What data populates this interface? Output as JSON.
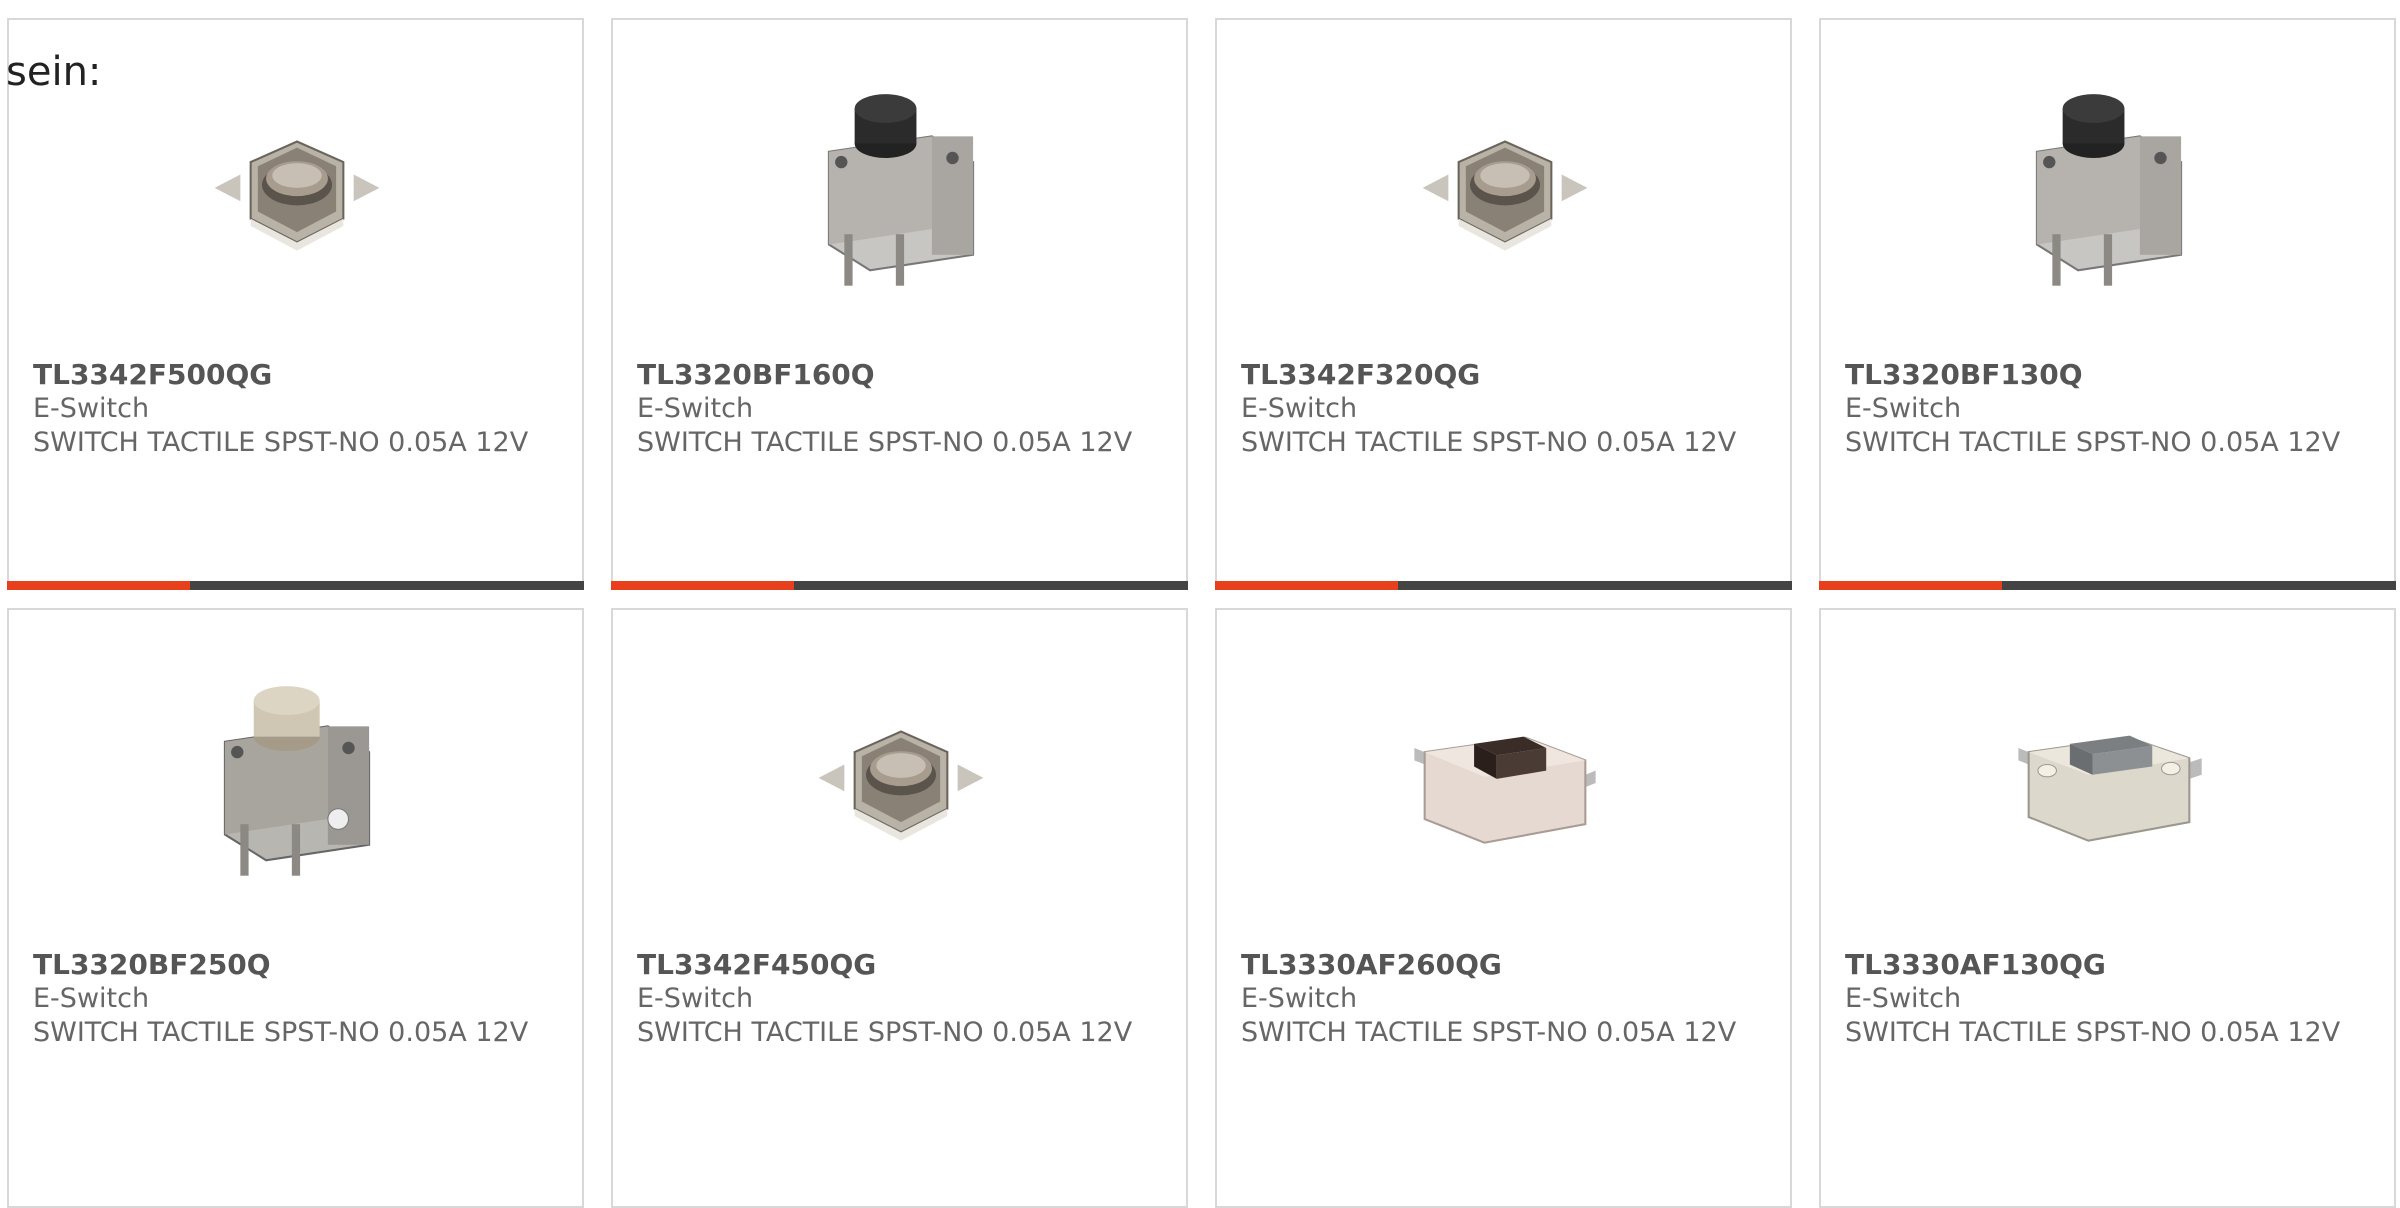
{
  "intro_text": "sein:",
  "colors": {
    "accent": "#e8401c",
    "bar": "#444444",
    "card_border": "#d8d8d8",
    "text": "#666666"
  },
  "products": [
    {
      "part": "TL3342F500QG",
      "maker": "E-Switch",
      "desc": "SWITCH TACTILE SPST-NO 0.05A 12V",
      "image": "smd-tactile-switch-metal"
    },
    {
      "part": "TL3320BF160Q",
      "maker": "E-Switch",
      "desc": "SWITCH TACTILE SPST-NO 0.05A 12V",
      "image": "right-angle-tactile-switch-black"
    },
    {
      "part": "TL3342F320QG",
      "maker": "E-Switch",
      "desc": "SWITCH TACTILE SPST-NO 0.05A 12V",
      "image": "smd-tactile-switch-metal"
    },
    {
      "part": "TL3320BF130Q",
      "maker": "E-Switch",
      "desc": "SWITCH TACTILE SPST-NO 0.05A 12V",
      "image": "right-angle-tactile-switch-black"
    },
    {
      "part": "TL3320BF250Q",
      "maker": "E-Switch",
      "desc": "SWITCH TACTILE SPST-NO 0.05A 12V",
      "image": "right-angle-tactile-switch-beige"
    },
    {
      "part": "TL3342F450QG",
      "maker": "E-Switch",
      "desc": "SWITCH TACTILE SPST-NO 0.05A 12V",
      "image": "smd-tactile-switch-metal"
    },
    {
      "part": "TL3330AF260QG",
      "maker": "E-Switch",
      "desc": "SWITCH TACTILE SPST-NO 0.05A 12V",
      "image": "rectangular-tactile-switch-brown"
    },
    {
      "part": "TL3330AF130QG",
      "maker": "E-Switch",
      "desc": "SWITCH TACTILE SPST-NO 0.05A 12V",
      "image": "rectangular-tactile-switch-gray"
    }
  ]
}
